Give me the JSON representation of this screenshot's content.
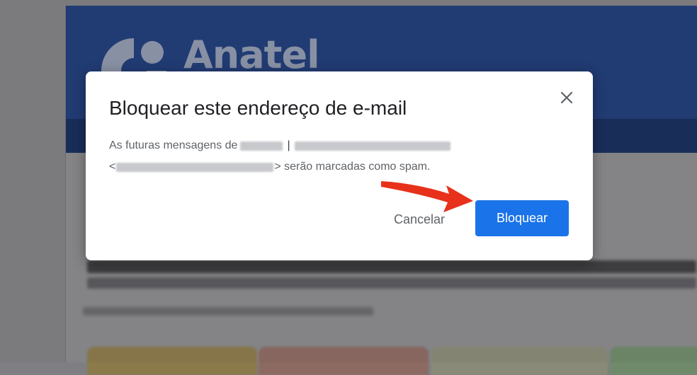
{
  "background_email": {
    "logo_text": "Anatel",
    "banner_color": "#1f3b78"
  },
  "dialog": {
    "title": "Bloquear este endereço de e-mail",
    "body_line1_prefix": "As futuras mensagens de",
    "body_separator": "|",
    "body_line2_open": "<",
    "body_line2_suffix": "> serão marcadas como spam.",
    "close_icon": "close-icon",
    "cancel_label": "Cancelar",
    "block_label": "Bloquear",
    "primary_color": "#1a73e8"
  },
  "annotation": {
    "arrow_icon": "arrow-pointer-icon",
    "arrow_color": "#e8311a"
  }
}
